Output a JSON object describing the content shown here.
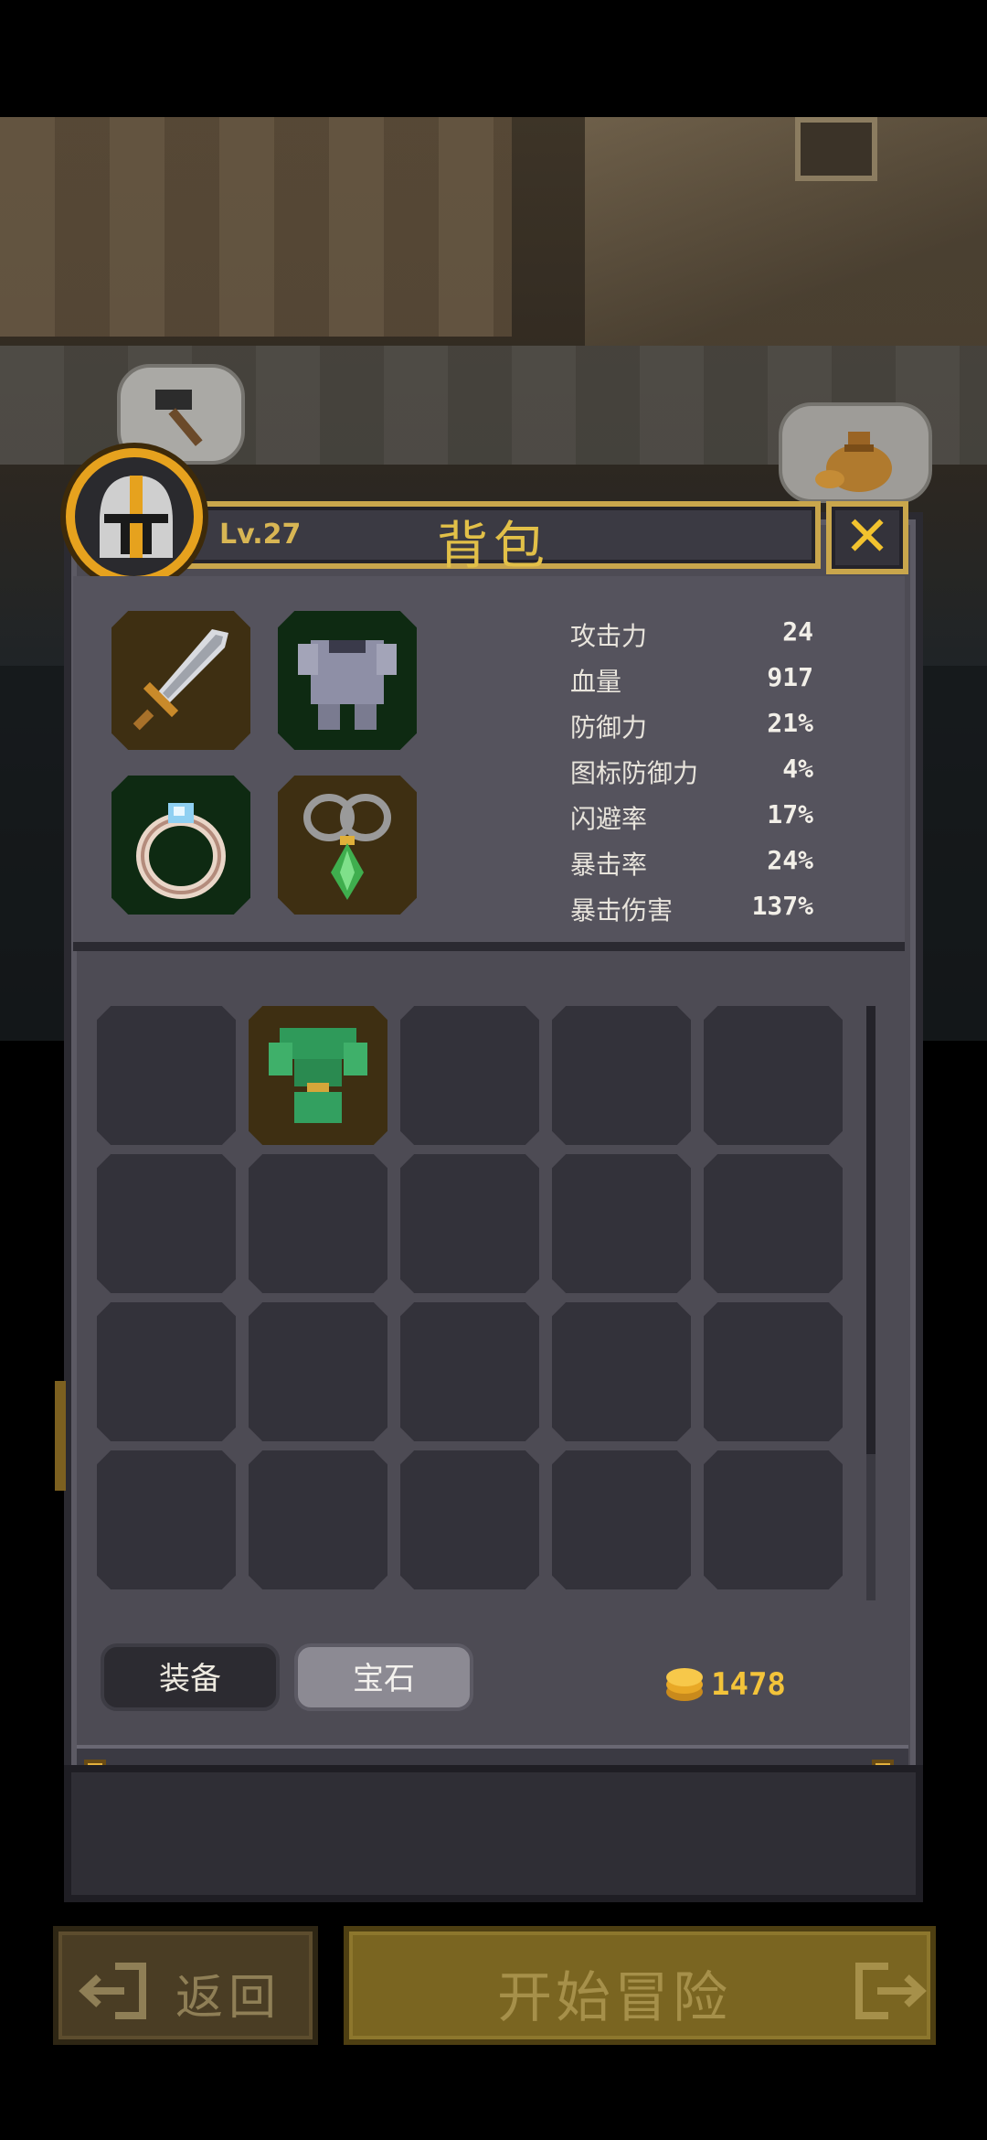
{
  "header": {
    "level": "Lv.27",
    "title": "背包",
    "close_icon": "close-x"
  },
  "equipment": {
    "slots": [
      {
        "name": "sword",
        "icon": "sword-icon"
      },
      {
        "name": "chest-armor",
        "icon": "chainmail-icon"
      },
      {
        "name": "ring",
        "icon": "ring-icon"
      },
      {
        "name": "amulet",
        "icon": "amulet-icon"
      }
    ]
  },
  "stats": [
    {
      "label": "攻击力",
      "value": "24"
    },
    {
      "label": "血量",
      "value": "917"
    },
    {
      "label": "防御力",
      "value": "21%"
    },
    {
      "label": "图标防御力",
      "value": "4%"
    },
    {
      "label": "闪避率",
      "value": "17%"
    },
    {
      "label": "暴击率",
      "value": "24%"
    },
    {
      "label": "暴击伤害",
      "value": "137%"
    }
  ],
  "inventory": {
    "columns": 5,
    "rows": 4,
    "filled_items": [
      {
        "index": 1,
        "icon": "green-cloak-icon"
      }
    ]
  },
  "tabs": {
    "equip_label": "装备",
    "gem_label": "宝石",
    "active": "宝石"
  },
  "currency": {
    "gold": "1478",
    "icon": "gold-coin-icon"
  },
  "buttons": {
    "back_label": "返回",
    "start_label": "开始冒险"
  },
  "colors": {
    "accent_gold": "#e2c048",
    "panel_bg": "#4d4b54",
    "slot_green": "#0e2a12",
    "slot_brown": "#3e2f12"
  }
}
